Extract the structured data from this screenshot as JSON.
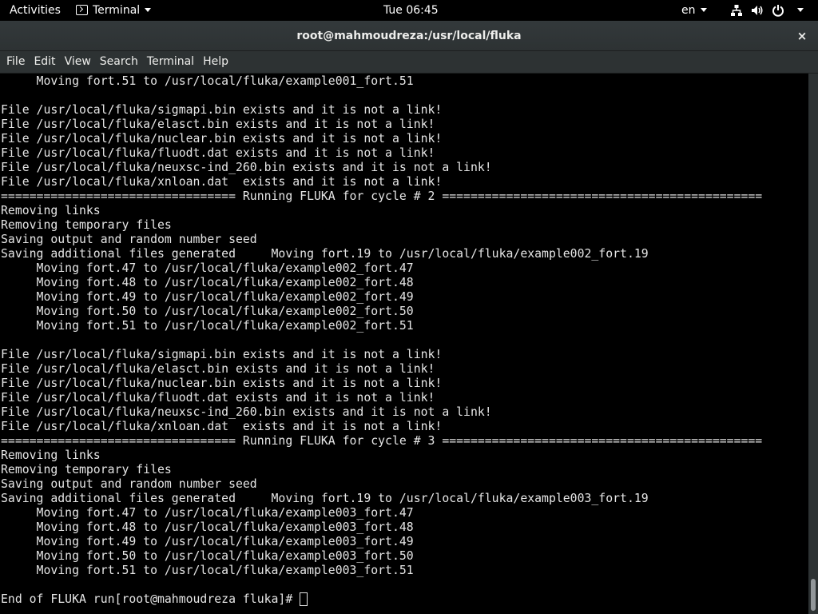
{
  "topbar": {
    "activities": "Activities",
    "app_name": "Terminal",
    "clock": "Tue 06:45",
    "lang": "en",
    "icons": [
      "network-icon",
      "volume-icon",
      "power-icon"
    ]
  },
  "window": {
    "title": "root@mahmoudreza:/usr/local/fluka",
    "close": "×"
  },
  "menubar": {
    "items": [
      "File",
      "Edit",
      "View",
      "Search",
      "Terminal",
      "Help"
    ]
  },
  "terminal": {
    "lines": [
      "     Moving fort.51 to /usr/local/fluka/example001_fort.51",
      "",
      "File /usr/local/fluka/sigmapi.bin exists and it is not a link!",
      "File /usr/local/fluka/elasct.bin exists and it is not a link!",
      "File /usr/local/fluka/nuclear.bin exists and it is not a link!",
      "File /usr/local/fluka/fluodt.dat exists and it is not a link!",
      "File /usr/local/fluka/neuxsc-ind_260.bin exists and it is not a link!",
      "File /usr/local/fluka/xnloan.dat  exists and it is not a link!",
      "================================= Running FLUKA for cycle # 2 =============================================",
      "Removing links",
      "Removing temporary files",
      "Saving output and random number seed",
      "Saving additional files generated     Moving fort.19 to /usr/local/fluka/example002_fort.19",
      "     Moving fort.47 to /usr/local/fluka/example002_fort.47",
      "     Moving fort.48 to /usr/local/fluka/example002_fort.48",
      "     Moving fort.49 to /usr/local/fluka/example002_fort.49",
      "     Moving fort.50 to /usr/local/fluka/example002_fort.50",
      "     Moving fort.51 to /usr/local/fluka/example002_fort.51",
      "",
      "File /usr/local/fluka/sigmapi.bin exists and it is not a link!",
      "File /usr/local/fluka/elasct.bin exists and it is not a link!",
      "File /usr/local/fluka/nuclear.bin exists and it is not a link!",
      "File /usr/local/fluka/fluodt.dat exists and it is not a link!",
      "File /usr/local/fluka/neuxsc-ind_260.bin exists and it is not a link!",
      "File /usr/local/fluka/xnloan.dat  exists and it is not a link!",
      "================================= Running FLUKA for cycle # 3 =============================================",
      "Removing links",
      "Removing temporary files",
      "Saving output and random number seed",
      "Saving additional files generated     Moving fort.19 to /usr/local/fluka/example003_fort.19",
      "     Moving fort.47 to /usr/local/fluka/example003_fort.47",
      "     Moving fort.48 to /usr/local/fluka/example003_fort.48",
      "     Moving fort.49 to /usr/local/fluka/example003_fort.49",
      "     Moving fort.50 to /usr/local/fluka/example003_fort.50",
      "     Moving fort.51 to /usr/local/fluka/example003_fort.51",
      "",
      "End of FLUKA run[root@mahmoudreza fluka]# "
    ]
  },
  "colors": {
    "terminal_bg": "#000000",
    "terminal_fg": "#e5e5e5",
    "chrome_bg": "#2d3233"
  }
}
